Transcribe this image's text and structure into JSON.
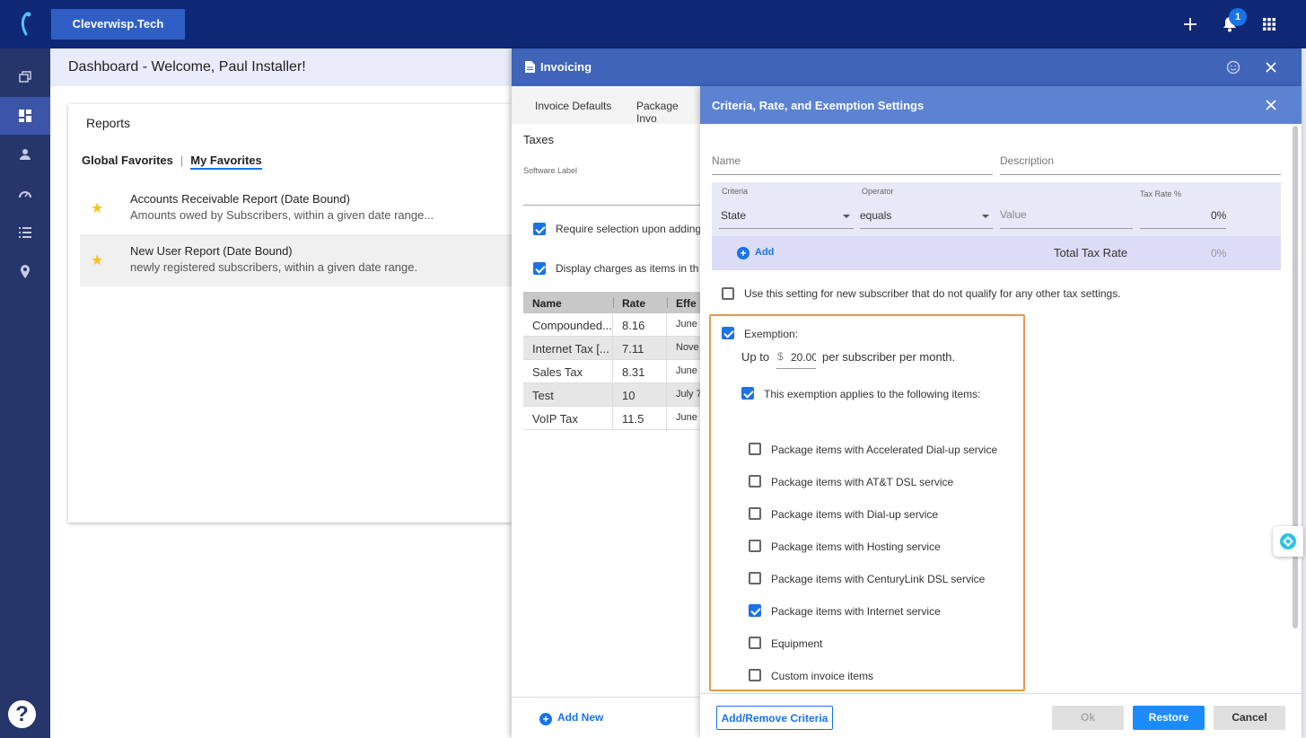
{
  "topbar": {
    "brand": "Cleverwisp.Tech",
    "notification_count": "1"
  },
  "dashboard": {
    "title": "Dashboard - Welcome, Paul Installer!",
    "reports": {
      "title": "Reports",
      "tabs": [
        "Global Favorites",
        "My Favorites"
      ],
      "tab_separator": "|",
      "items": [
        {
          "title": "Accounts Receivable Report (Date Bound)",
          "desc": "Amounts owed by Subscribers, within a given date range..."
        },
        {
          "title": "New User Report (Date Bound)",
          "desc": "newly registered subscribers, within a given date range."
        }
      ]
    }
  },
  "invoicing": {
    "title": "Invoicing",
    "tabs": [
      "Invoice Defaults",
      "Package Invo"
    ],
    "section": "Taxes",
    "software_label": "Software Label",
    "checkbox1": "Require selection upon adding",
    "checkbox2": "Display charges as items in th",
    "table": {
      "headers": [
        "Name",
        "Rate",
        "Effe"
      ],
      "rows": [
        [
          "Compounded...",
          "8.16",
          "June"
        ],
        [
          "Internet Tax [...",
          "7.11",
          "Nove"
        ],
        [
          "Sales Tax",
          "8.31",
          "June"
        ],
        [
          "Test",
          "10",
          "July 7"
        ],
        [
          "VoIP Tax",
          "11.5",
          "June"
        ]
      ]
    },
    "add_new": "Add New"
  },
  "criteria": {
    "title": "Criteria, Rate, and Exemption Settings",
    "name_placeholder": "Name",
    "description_placeholder": "Description",
    "grid": {
      "criteria_label": "Criteria",
      "criteria_value": "State",
      "operator_label": "Operator",
      "operator_value": "equals",
      "value_placeholder": "Value",
      "tax_rate_label": "Tax Rate %",
      "tax_rate_value": "0%"
    },
    "add": "Add",
    "total_tax_rate_label": "Total Tax Rate",
    "total_tax_rate_value": "0%",
    "new_subscriber_setting": "Use this setting for new subscriber that do not qualify for any other tax settings.",
    "exemption": {
      "label": "Exemption:",
      "up_to": "Up to",
      "currency": "$",
      "amount": "20.00",
      "per": "per subscriber per month.",
      "applies": "This exemption applies to the following items:",
      "items": [
        {
          "label": "Package items with Accelerated Dial-up service",
          "checked": false
        },
        {
          "label": "Package items with AT&T DSL service",
          "checked": false
        },
        {
          "label": "Package items with Dial-up service",
          "checked": false
        },
        {
          "label": "Package items with Hosting service",
          "checked": false
        },
        {
          "label": "Package items with CenturyLink DSL service",
          "checked": false
        },
        {
          "label": "Package items with Internet service",
          "checked": true
        },
        {
          "label": "Equipment",
          "checked": false
        },
        {
          "label": "Custom invoice items",
          "checked": false
        }
      ]
    },
    "buttons": {
      "add_remove": "Add/Remove Criteria",
      "ok": "Ok",
      "restore": "Restore",
      "cancel": "Cancel"
    }
  },
  "colors": {
    "topbar": "#0f2876",
    "nav": "#26356a",
    "accent": "#1a73e8",
    "highlight_border": "#e69a4d"
  }
}
